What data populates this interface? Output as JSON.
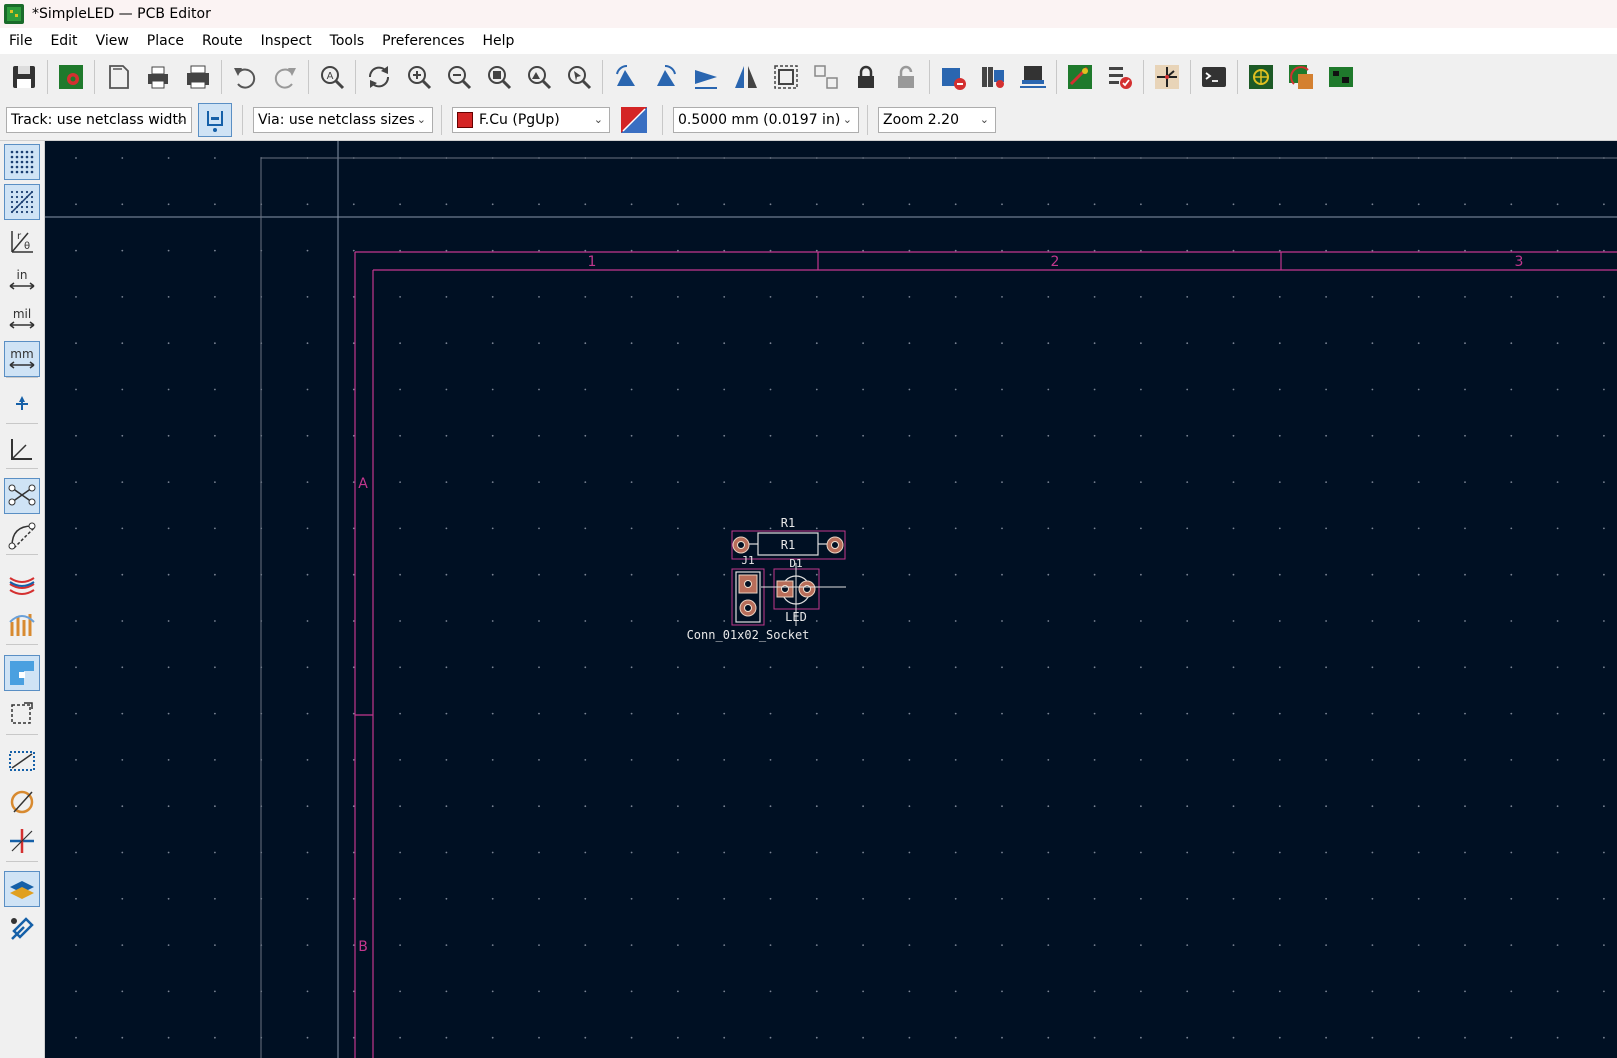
{
  "window": {
    "title": "*SimpleLED — PCB Editor"
  },
  "menu": [
    {
      "label": "File",
      "name": "menu-file"
    },
    {
      "label": "Edit",
      "name": "menu-edit"
    },
    {
      "label": "View",
      "name": "menu-view"
    },
    {
      "label": "Place",
      "name": "menu-place"
    },
    {
      "label": "Route",
      "name": "menu-route"
    },
    {
      "label": "Inspect",
      "name": "menu-inspect"
    },
    {
      "label": "Tools",
      "name": "menu-tools"
    },
    {
      "label": "Preferences",
      "name": "menu-preferences"
    },
    {
      "label": "Help",
      "name": "menu-help"
    }
  ],
  "toolbar": {
    "icons": [
      "save-icon",
      "board-setup-icon",
      "page-settings-icon",
      "print-icon",
      "plot-icon",
      "undo-icon",
      "redo-icon",
      "find-icon",
      "redraw-icon",
      "zoom-in-icon",
      "zoom-out-icon",
      "zoom-fit-icon",
      "zoom-objects-icon",
      "zoom-selection-icon",
      "rotate-ccw-icon",
      "rotate-cw-icon",
      "flip-icon",
      "mirror-icon",
      "group-icon",
      "ungroup-icon",
      "lock-icon",
      "unlock-icon",
      "footprint-editor-icon",
      "footprint-library-icon",
      "footprint-browser-icon",
      "update-pcb-icon",
      "drc-icon",
      "schematic-icon",
      "scripting-console-icon",
      "3d-viewer-icon",
      "footprint-swap-icon",
      "board-icon"
    ]
  },
  "options": {
    "track": "Track: use netclass width",
    "via": "Via: use netclass sizes",
    "layer": "F.Cu (PgUp)",
    "grid": "0.5000 mm (0.0197 in)",
    "zoom": "Zoom 2.20",
    "layer_color": "#d42525"
  },
  "leftbar": {
    "icons": [
      "grid-dots-icon",
      "grid-overrides-icon",
      "polar-coords-icon",
      "units-inches-icon",
      "units-mils-icon",
      "units-mm-icon",
      "cursor-shape-icon",
      "local-origin-icon",
      "ratsnest-icon",
      "curved-ratsnest-icon",
      "high-contrast-icon",
      "net-color-icon",
      "fill-zones-icon",
      "selection-filter-icon",
      "draw-outline-icon",
      "via-outline-icon",
      "track-outline-icon",
      "layers-manager-icon",
      "properties-tool-icon"
    ]
  },
  "canvas": {
    "background": "#001023",
    "frame_color": "#c2378e",
    "column_labels": [
      "1",
      "2",
      "3"
    ],
    "row_labels": [
      "A",
      "B"
    ],
    "components": {
      "r1_ref": "R1",
      "r1_value": "R1",
      "j1_ref": "J1",
      "j1_value": "Conn_01x02_Socket",
      "d1_ref": "D1",
      "d1_value": "LED"
    }
  }
}
